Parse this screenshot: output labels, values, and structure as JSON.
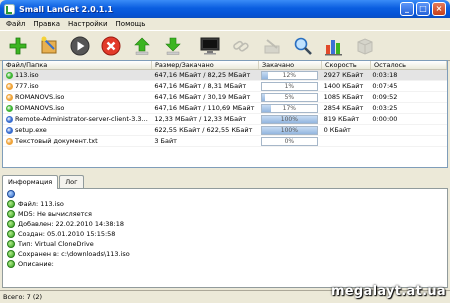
{
  "window": {
    "title": "Small LanGet 2.0.1.1"
  },
  "menu": [
    "Файл",
    "Правка",
    "Настройки",
    "Помощь"
  ],
  "toolbar": [
    {
      "name": "add-icon",
      "disabled": false
    },
    {
      "name": "wizard-icon",
      "disabled": false
    },
    {
      "name": "start-icon",
      "disabled": false
    },
    {
      "name": "stop-icon",
      "disabled": false
    },
    {
      "name": "move-up-icon",
      "disabled": false
    },
    {
      "name": "move-down-icon",
      "disabled": false
    },
    {
      "name": "monitor-icon",
      "disabled": false
    },
    {
      "name": "link-icon",
      "disabled": true
    },
    {
      "name": "tools-icon",
      "disabled": true
    },
    {
      "name": "search-icon",
      "disabled": false
    },
    {
      "name": "stats-icon",
      "disabled": false
    },
    {
      "name": "box-icon",
      "disabled": true
    }
  ],
  "grid": {
    "headers": [
      "Файл/Папка",
      "Размер/Закачано",
      "Закачано",
      "Скорость",
      "Осталось"
    ],
    "rows": [
      {
        "name": "113.iso",
        "size": "647,16 МБайт / 82,25 МБайт",
        "progress": "12%",
        "fill": 0.12,
        "speed": "2927 КБайт",
        "left": "0:03:18",
        "status": "green",
        "selected": true
      },
      {
        "name": "777.iso",
        "size": "647,16 МБайт / 8,31 МБайт",
        "progress": "1%",
        "fill": 0.01,
        "speed": "1400 КБайт",
        "left": "0:07:45",
        "status": "orange",
        "selected": false
      },
      {
        "name": "ROMANOVS.iso",
        "size": "647,16 МБайт / 30,19 МБайт",
        "progress": "5%",
        "fill": 0.05,
        "speed": "1085 КБайт",
        "left": "0:09:52",
        "status": "orange",
        "selected": false
      },
      {
        "name": "ROMANOVS.iso",
        "size": "647,16 МБайт / 110,69 МБайт",
        "progress": "17%",
        "fill": 0.17,
        "speed": "2854 КБайт",
        "left": "0:03:25",
        "status": "green",
        "selected": false
      },
      {
        "name": "Remote-Administrator-server-client-3.3...",
        "size": "12,33 МБайт / 12,33 МБайт",
        "progress": "100%",
        "fill": 1.0,
        "speed": "819 КБайт",
        "left": "0:00:00",
        "status": "blue",
        "selected": false
      },
      {
        "name": "setup.exe",
        "size": "622,55 КБайт / 622,55 КБайт",
        "progress": "100%",
        "fill": 1.0,
        "speed": "0 КБайт",
        "left": "",
        "status": "blue",
        "selected": false
      },
      {
        "name": "Текстовый документ.txt",
        "size": "3 Байт",
        "progress": "0%",
        "fill": 0.0,
        "speed": "",
        "left": "",
        "status": "orange",
        "selected": false
      }
    ]
  },
  "tabs": [
    "Информация",
    "Лог"
  ],
  "info": [
    {
      "text": "",
      "badge": "blue"
    },
    {
      "text": "Файл: 113.iso",
      "badge": "green"
    },
    {
      "text": "MD5: Не вычисляется",
      "badge": "green"
    },
    {
      "text": "Добавлен: 22.02.2010 14:38:18",
      "badge": "green"
    },
    {
      "text": "Создан: 05.01.2010 15:15:58",
      "badge": "green"
    },
    {
      "text": "Тип: Virtual CloneDrive",
      "badge": "green"
    },
    {
      "text": "Сохранен в: c:\\downloads\\113.iso",
      "badge": "green"
    },
    {
      "text": "Описание:",
      "badge": "green"
    }
  ],
  "status": {
    "text": "Всего: 7 (2)"
  },
  "watermark": "megalayt.at.ua",
  "colors": {
    "green": "#3fb536",
    "orange": "#f0a43a",
    "blue": "#3a6fd0"
  }
}
